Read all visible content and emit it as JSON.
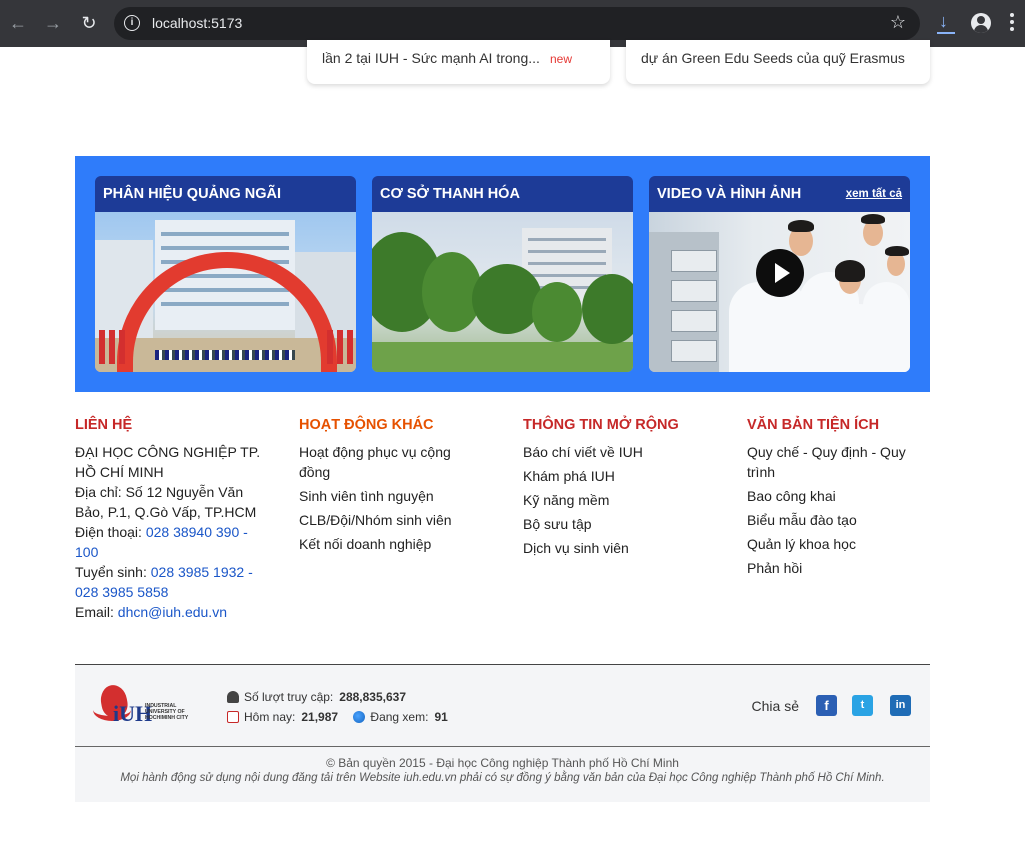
{
  "browser": {
    "url": "localhost:5173",
    "back_icon": "←",
    "forward_icon": "→",
    "reload_icon": "↻",
    "info_icon": "i",
    "star_icon": "☆",
    "download_icon": "⭳"
  },
  "news": [
    {
      "text": "lần 2 tại IUH - Sức mạnh AI trong...",
      "badge": "new"
    },
    {
      "text": "dự án Green Edu Seeds của quỹ Erasmus"
    }
  ],
  "media": [
    {
      "title": "PHÂN HIỆU QUẢNG NGÃI"
    },
    {
      "title": "CƠ SỞ THANH HÓA"
    },
    {
      "title": "VIDEO VÀ HÌNH ẢNH",
      "more": "xem tất cả"
    }
  ],
  "contact": {
    "heading": "LIÊN HỆ",
    "lines": [
      "ĐẠI HỌC CÔNG NGHIỆP TP.",
      "HỒ CHÍ MINH",
      "Địa chỉ: Số 12 Nguyễn Văn",
      "Bảo, P.1, Q.Gò Vấp, TP.HCM"
    ],
    "phone_label": "Điện thoại: ",
    "phone_a": "028 38940 390 -",
    "phone_b": "100",
    "admission_label": "Tuyển sinh: ",
    "admission_a": "028 3985 1932 -",
    "admission_b": "028 3985 5858",
    "email_label": "Email: ",
    "email": "dhcn@iuh.edu.vn"
  },
  "activities": {
    "heading": "HOẠT ĐỘNG KHÁC",
    "items": [
      "Hoạt động phục vụ cộng đồng",
      "Sinh viên tình nguyện",
      "CLB/Đội/Nhóm sinh viên",
      "Kết nối doanh nghiệp"
    ]
  },
  "more_info": {
    "heading": "THÔNG TIN MỞ RỘNG",
    "items": [
      "Báo chí viết về IUH",
      "Khám phá IUH",
      "Kỹ năng mềm",
      "Bộ sưu tập",
      "Dịch vụ sinh viên"
    ]
  },
  "documents": {
    "heading": "VĂN BẢN TIỆN ÍCH",
    "items": [
      "Quy chế - Quy định - Quy trình",
      "Bao công khai",
      "Biểu mẫu đào tạo",
      "Quản lý khoa học",
      "Phản hồi"
    ]
  },
  "logo": {
    "mono": "iUH",
    "text": "INDUSTRIAL UNIVERSITY OF HOCHIMINH CITY"
  },
  "stats": {
    "visits_label": "Số lượt truy cập:",
    "visits": "288,835,637",
    "today_label": "Hôm nay:",
    "today": "21,987",
    "online_label": "Đang xem:",
    "online": "91"
  },
  "share": {
    "label": "Chia sẻ",
    "facebook": "f",
    "twitter": "t",
    "linkedin": "in"
  },
  "copyright": {
    "line1": "© Bản quyền 2015 - Đại học Công nghiệp Thành phố Hồ Chí Minh",
    "line2": "Mọi hành động sử dụng nội dung đăng tải trên Website iuh.edu.vn phải có sự đồng ý bằng văn bản của Đại học Công nghiệp Thành phố Hồ Chí Minh."
  }
}
